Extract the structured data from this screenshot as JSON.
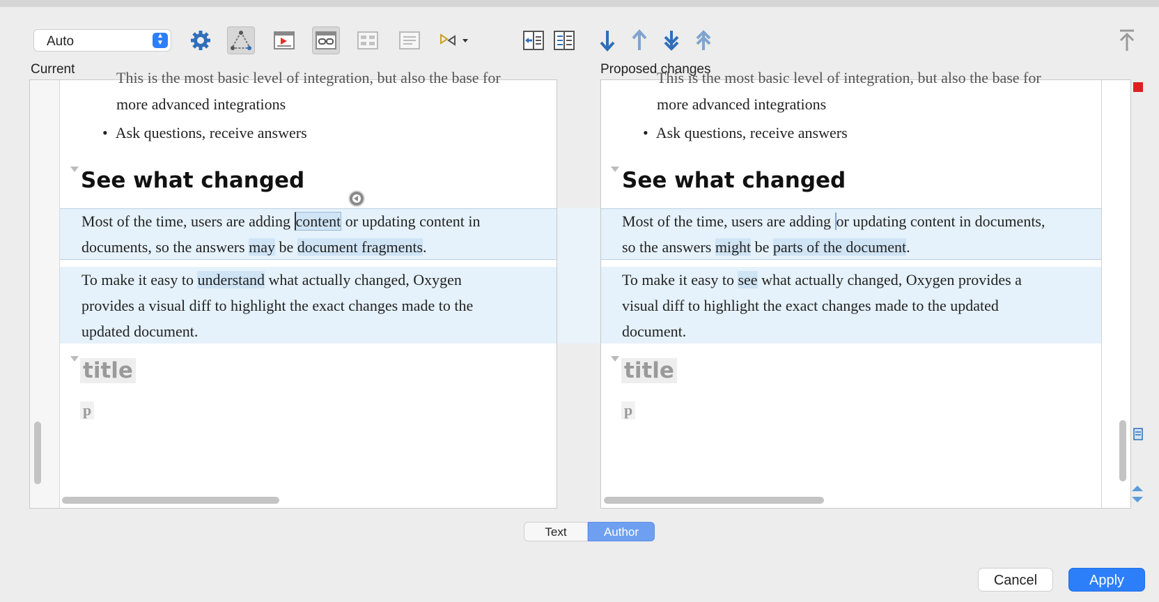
{
  "toolbar": {
    "mode_select_value": "Auto",
    "icons": [
      "gear-icon",
      "outline-diff-icon",
      "show-changes-icon",
      "word-diff-icon",
      "block-diff-icon",
      "paragraph-diff-icon",
      "merge-arrows-icon",
      "copy-left-icon",
      "copy-all-left-icon",
      "next-change-icon",
      "previous-change-icon",
      "last-change-icon",
      "first-change-icon",
      "scroll-top-icon"
    ]
  },
  "panes": {
    "current_label": "Current",
    "proposed_label": "Proposed changes"
  },
  "current": {
    "cut_line": "This is the most basic level of integration, but also the base for",
    "bullet_cont": "more advanced integrations",
    "bullet2": "Ask questions, receive answers",
    "heading": "See what changed",
    "para1": {
      "t1": "Most of the time, users are adding ",
      "h1": "content",
      "t2": " or updating content in",
      "t3": "documents, so the answers ",
      "h2": "may",
      "t4": " be ",
      "h3": "document fragments",
      "t5": "."
    },
    "para2": {
      "t1": "To make it easy to ",
      "h1": "understand",
      "t2": " what actually changed, Oxygen",
      "l2": "provides a visual diff to highlight the exact changes made to the",
      "l3": "updated document."
    },
    "title_tag": "title",
    "p_tag": "p"
  },
  "proposed": {
    "cut_line": "This is the most basic level of integration, but also the base for",
    "bullet_cont": "more advanced integrations",
    "bullet2": "Ask questions, receive answers",
    "heading": "See what changed",
    "para1": {
      "t1": "Most of the time, users are adding ",
      "t2": "or updating content in documents,",
      "t3": "so the answers ",
      "h1": "might",
      "t4": " be ",
      "h2": "parts of the document",
      "t5": "."
    },
    "para2": {
      "t1": "To make it easy to ",
      "h1": "see",
      "t2": " what actually changed, Oxygen provides a",
      "l2": "visual diff to highlight the exact changes made to the updated",
      "l3": "document."
    },
    "title_tag": "title",
    "p_tag": "p"
  },
  "view_tabs": {
    "text": "Text",
    "author": "Author"
  },
  "buttons": {
    "cancel": "Cancel",
    "apply": "Apply"
  },
  "colors": {
    "accent": "#2d7ff9",
    "change_band": "#e5f2fb",
    "change_highlight": "#cfe4f5",
    "arrow_blue": "#2f6fba"
  }
}
